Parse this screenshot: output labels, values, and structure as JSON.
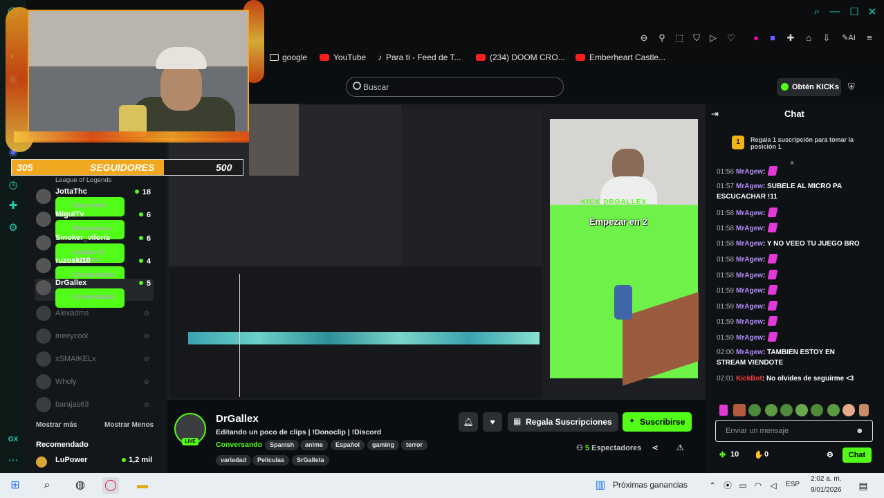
{
  "bookmarks": [
    {
      "label": "google",
      "icon": "folder-icon"
    },
    {
      "label": "YouTube",
      "icon": "youtube-icon"
    },
    {
      "label": "Para ti - Feed de T...",
      "icon": "tiktok-icon"
    },
    {
      "label": "(234) DOOM CRO...",
      "icon": "youtube-icon"
    },
    {
      "label": "Emberheart Castle...",
      "icon": "youtube-icon"
    }
  ],
  "search": {
    "placeholder": "Buscar"
  },
  "header": {
    "kicks_button": "Obtén KICKs"
  },
  "overlay": {
    "goal_current": "305",
    "goal_label": "SEGUIDORES",
    "goal_target": "500",
    "game_label": "KICK DRGALLEX",
    "game_text": "Empezar en 2"
  },
  "channels": [
    {
      "name": "JottaThc",
      "sub": "Green Hell",
      "count": "18"
    },
    {
      "name": "MiguiTv",
      "sub": "Movierooms",
      "count": "6"
    },
    {
      "name": "Smoker_viloria",
      "sub": "League of Legends",
      "count": "6"
    },
    {
      "name": "ruzoski10",
      "sub": "Conversando",
      "count": "4"
    },
    {
      "name": "DrGallex",
      "sub": "Conversando",
      "count": "5"
    }
  ],
  "channels_top_partial": "League of Legends",
  "offline_channels": [
    "Alexadms",
    "meeycool",
    "xSMAIKELx",
    "Wholy",
    "barajas63"
  ],
  "sidebar": {
    "show_more": "Mostrar más",
    "show_less": "Mostrar Menos",
    "recommended": "Recomendado",
    "rec_name": "LuPower",
    "rec_count": "1,2 mil"
  },
  "stream": {
    "name": "DrGallex",
    "live": "LIVE",
    "title": "Editando un poco de clips | !Donoclip | !Discord",
    "category": "Conversando",
    "tags": [
      "Spanish",
      "anime",
      "Español",
      "gaming",
      "terror",
      "variedad",
      "Películas",
      "SrGalleta"
    ],
    "gift_label": "Regala Suscripciones",
    "subscribe_label": "Suscribirse",
    "viewers": "5",
    "viewers_label": "Espectadores"
  },
  "chat": {
    "title": "Chat",
    "promo": "Regala 1 suscripción para tomar la posición 1",
    "promo_badge": "1",
    "messages": [
      {
        "ts": "01:56",
        "user": "MrAgew",
        "text": "",
        "emote": true
      },
      {
        "ts": "01:57",
        "user": "MrAgew",
        "text": "SUBELE AL MICRO PA ESCUCACHAR !11",
        "emote": false
      },
      {
        "ts": "01:58",
        "user": "MrAgew",
        "text": "",
        "emote": true
      },
      {
        "ts": "01:58",
        "user": "MrAgew",
        "text": "",
        "emote": true
      },
      {
        "ts": "01:58",
        "user": "MrAgew",
        "text": "Y NO VEEO TU JUEGO BRO",
        "emote": false
      },
      {
        "ts": "01:58",
        "user": "MrAgew",
        "text": "",
        "emote": true
      },
      {
        "ts": "01:58",
        "user": "MrAgew",
        "text": "",
        "emote": true
      },
      {
        "ts": "01:59",
        "user": "MrAgew",
        "text": "",
        "emote": true
      },
      {
        "ts": "01:59",
        "user": "MrAgew",
        "text": "",
        "emote": true
      },
      {
        "ts": "01:59",
        "user": "MrAgew",
        "text": "",
        "emote": true
      },
      {
        "ts": "01:59",
        "user": "MrAgew",
        "text": "",
        "emote": true
      },
      {
        "ts": "02:00",
        "user": "MrAgew",
        "text": "TAMBIEN ESTOY EN STREAM VIENDOTE",
        "emote": false
      },
      {
        "ts": "02:01",
        "user": "KickBot",
        "text": "No olvides de seguirme <3",
        "emote": false
      }
    ],
    "input_placeholder": "Enviar un mensaje",
    "points": "10",
    "likes": "0",
    "send_label": "Chat"
  },
  "taskbar": {
    "widget": "Próximas ganancias",
    "lang": "ESP",
    "time": "2:02 a. m.",
    "date": "9/01/2026"
  },
  "colors": {
    "kick_green": "#53fc18",
    "opera_teal": "#1fd0b5",
    "chat_user": "#b48cff"
  }
}
